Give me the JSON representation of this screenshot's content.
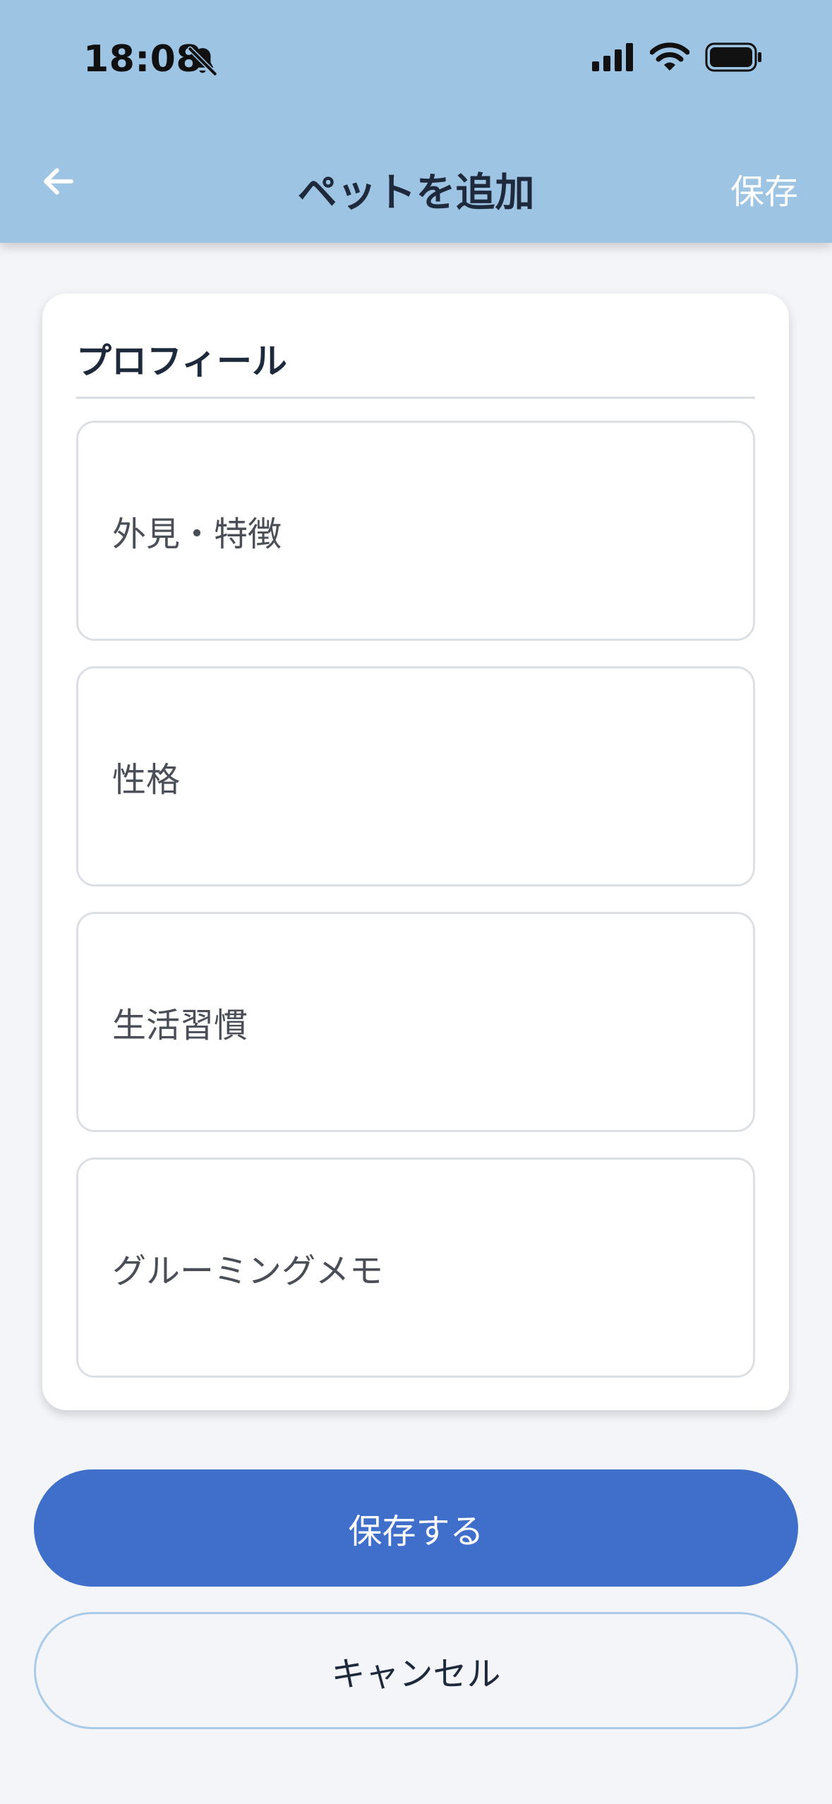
{
  "status_bar": {
    "time": "18:08",
    "icons": [
      "bell-slash-icon",
      "cellular-signal-icon",
      "wifi-icon",
      "battery-icon"
    ]
  },
  "nav": {
    "back_icon": "arrow-left-icon",
    "title": "ペットを追加",
    "save_label": "保存"
  },
  "profile": {
    "section_title": "プロフィール",
    "fields": [
      {
        "placeholder": "外見・特徴"
      },
      {
        "placeholder": "性格"
      },
      {
        "placeholder": "生活習慣"
      },
      {
        "placeholder": "グルーミングメモ"
      }
    ]
  },
  "actions": {
    "primary_label": "保存する",
    "secondary_label": "キャンセル"
  },
  "colors": {
    "header_bg": "#9ec4e4",
    "primary": "#3f6fcb",
    "background": "#f3f5f9"
  }
}
